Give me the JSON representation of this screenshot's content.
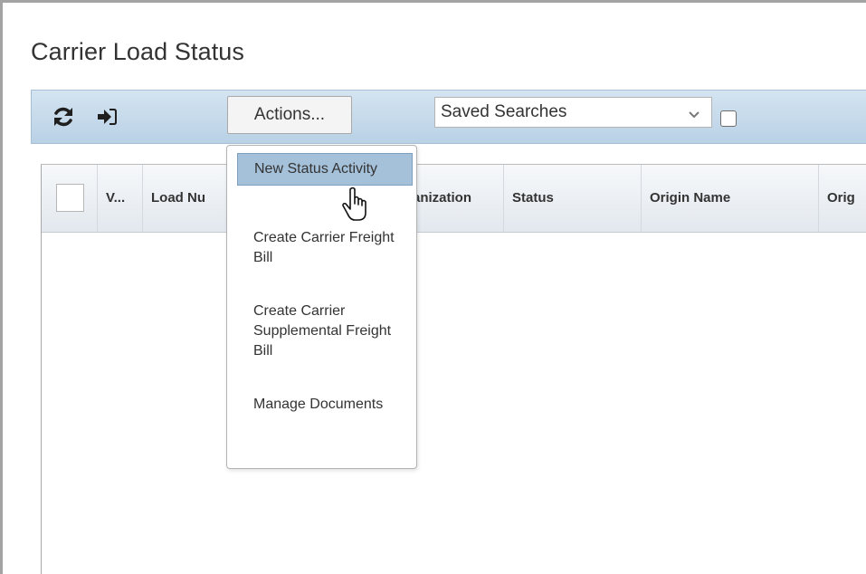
{
  "page": {
    "title": "Carrier Load Status"
  },
  "toolbar": {
    "refresh_icon": "refresh-icon",
    "signin_icon": "sign-in-arrow-icon",
    "actions_label": "Actions...",
    "saved_searches_value": "Saved Searches",
    "accent_color": "#c8dbec"
  },
  "grid": {
    "columns": [
      "V...",
      "Load Nu",
      "anization",
      "Status",
      "Origin Name",
      "Orig"
    ]
  },
  "actions_menu": {
    "items": [
      "New Status Activity",
      "Create Carrier Freight Bill",
      "Create Carrier Supplemental Freight Bill",
      "Manage Documents"
    ],
    "highlight_color": "#a5c1da"
  }
}
